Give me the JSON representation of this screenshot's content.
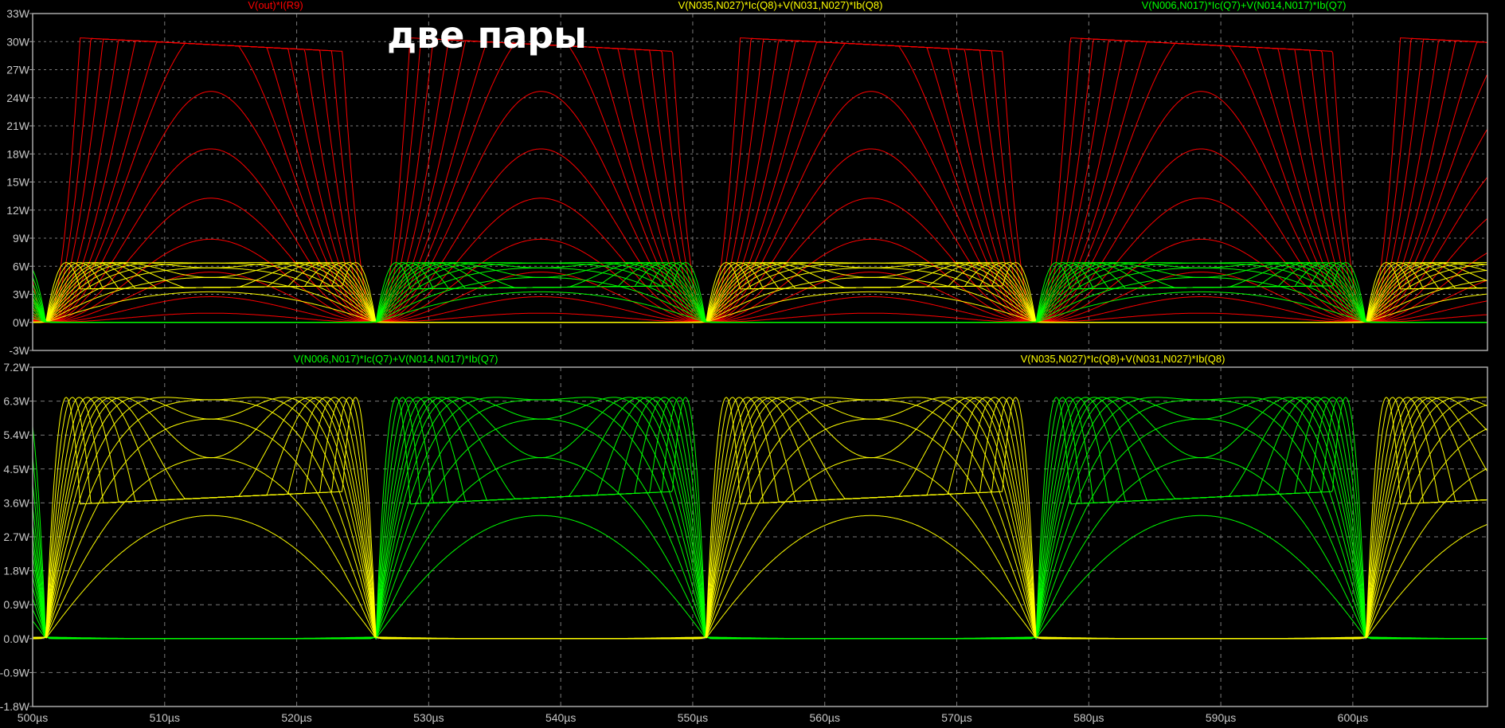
{
  "annotation": "две пары",
  "colors": {
    "red": "#ff0000",
    "yellow": "#ffff00",
    "green": "#00ff00",
    "frame": "#a8a8a8",
    "grid": "#7a7a7a",
    "tick": "#c8c8c8"
  },
  "chart_data": [
    {
      "type": "line",
      "title": "",
      "xlabel": "",
      "ylabel": "",
      "xlim": [
        500,
        610.2
      ],
      "ylim": [
        -3,
        33
      ],
      "x_ticks": [
        "500µs",
        "510µs",
        "520µs",
        "530µs",
        "540µs",
        "550µs",
        "560µs",
        "570µs",
        "580µs",
        "590µs",
        "600µs"
      ],
      "y_ticks": [
        "-3W",
        "0W",
        "3W",
        "6W",
        "9W",
        "12W",
        "15W",
        "18W",
        "21W",
        "24W",
        "27W",
        "30W",
        "33W"
      ],
      "y_tick_values": [
        -3,
        0,
        3,
        6,
        9,
        12,
        15,
        18,
        21,
        24,
        27,
        30,
        33
      ],
      "grid": true,
      "series": [
        {
          "name": "V(out)*I(R9)",
          "color": "red",
          "kind": "output",
          "peak_clipped": 29.5
        },
        {
          "name": "V(N035,N027)*Ic(Q8)+V(N031,N027)*Ib(Q8)",
          "color": "yellow",
          "kind": "pos",
          "peak": 6.4
        },
        {
          "name": "V(N006,N017)*Ic(Q7)+V(N014,N017)*Ib(Q7)",
          "color": "green",
          "kind": "neg",
          "peak": 6.4
        }
      ]
    },
    {
      "type": "line",
      "title": "",
      "xlabel": "",
      "ylabel": "",
      "xlim": [
        500,
        610.2
      ],
      "ylim": [
        -1.8,
        7.2
      ],
      "x_ticks": [
        "500µs",
        "510µs",
        "520µs",
        "530µs",
        "540µs",
        "550µs",
        "560µs",
        "570µs",
        "580µs",
        "590µs",
        "600µs"
      ],
      "y_ticks": [
        "-1.8W",
        "-0.9W",
        "0.0W",
        "0.9W",
        "1.8W",
        "2.7W",
        "3.6W",
        "4.5W",
        "5.4W",
        "6.3W",
        "7.2W"
      ],
      "y_tick_values": [
        -1.8,
        -0.9,
        0,
        0.9,
        1.8,
        2.7,
        3.6,
        4.5,
        5.4,
        6.3,
        7.2
      ],
      "grid": true,
      "series": [
        {
          "name": "V(N006,N017)*Ic(Q7)+V(N014,N017)*Ib(Q7)",
          "color": "green",
          "kind": "neg",
          "peak": 6.4,
          "clipped_plateau": 4.0
        },
        {
          "name": "V(N035,N027)*Ic(Q8)+V(N031,N027)*Ib(Q8)",
          "color": "yellow",
          "kind": "pos",
          "peak": 6.4,
          "clipped_plateau": 4.0
        }
      ]
    }
  ],
  "signal": {
    "period_us": 50,
    "first_zero_crossing_us": 501,
    "relative_amplitudes": [
      0.15,
      0.25,
      0.35,
      0.45,
      0.55,
      0.65,
      0.75,
      0.85,
      0.95,
      1.1,
      1.3,
      1.6,
      2.0,
      2.6
    ]
  }
}
